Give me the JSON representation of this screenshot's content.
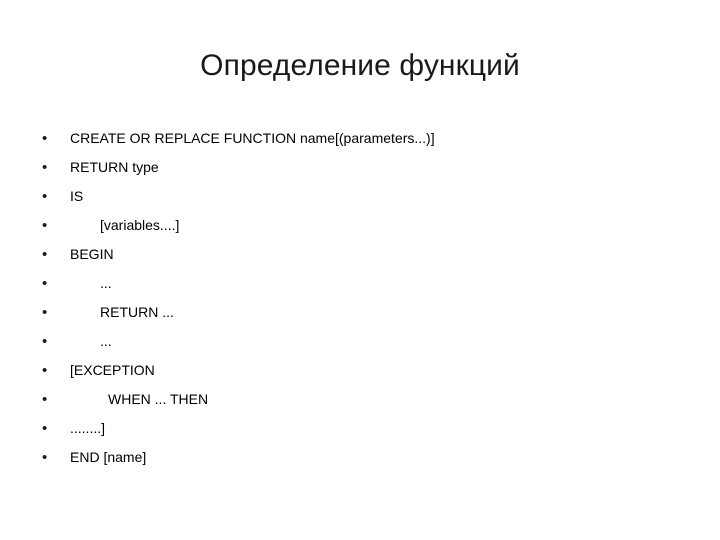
{
  "slide": {
    "title": "Определение функций",
    "background_color": "#ffffff",
    "text_color": "#000000",
    "title_color": "#1a1a1a"
  },
  "bullets": {
    "marker_glyph": "•",
    "items": [
      {
        "text": "CREATE OR REPLACE FUNCTION name[(parameters...)]",
        "indent": 0
      },
      {
        "text": "RETURN type",
        "indent": 0
      },
      {
        "text": "IS",
        "indent": 0
      },
      {
        "text": "[variables....]",
        "indent": 1
      },
      {
        "text": "BEGIN",
        "indent": 0
      },
      {
        "text": "...",
        "indent": 1
      },
      {
        "text": "RETURN ...",
        "indent": 1
      },
      {
        "text": "...",
        "indent": 1
      },
      {
        "text": "[EXCEPTION",
        "indent": 0
      },
      {
        "text": "WHEN ... THEN",
        "indent": 2
      },
      {
        "text": "........]",
        "indent": 0
      },
      {
        "text": "END [name]",
        "indent": 0
      }
    ]
  }
}
